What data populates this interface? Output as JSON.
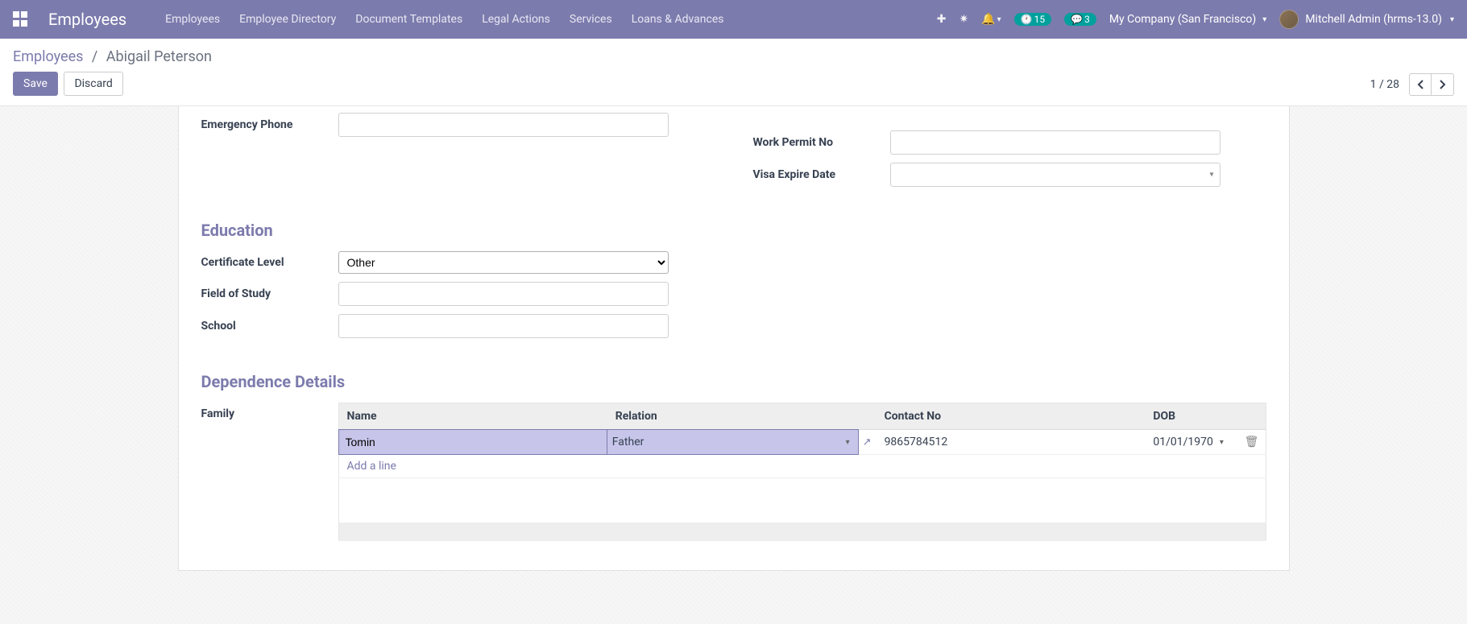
{
  "nav": {
    "brand": "Employees",
    "links": [
      "Employees",
      "Employee Directory",
      "Document Templates",
      "Legal Actions",
      "Services",
      "Loans & Advances"
    ],
    "activities": "15",
    "discuss": "3",
    "company": "My Company (San Francisco)",
    "user": "Mitchell Admin (hrms-13.0)"
  },
  "breadcrumbs": {
    "root": "Employees",
    "current": "Abigail Peterson"
  },
  "buttons": {
    "save": "Save",
    "discard": "Discard"
  },
  "pager": {
    "value": "1 / 28"
  },
  "fields": {
    "emergency_phone": "Emergency Phone",
    "work_permit_no": "Work Permit No",
    "visa_expire": "Visa Expire Date",
    "certificate_level": "Certificate Level",
    "certificate_value": "Other",
    "field_of_study": "Field of Study",
    "school": "School",
    "family": "Family"
  },
  "sections": {
    "education": "Education",
    "dependence": "Dependence Details"
  },
  "table": {
    "headers": {
      "name": "Name",
      "relation": "Relation",
      "contact": "Contact No",
      "dob": "DOB"
    },
    "rows": [
      {
        "name": "Tomin",
        "relation": "Father",
        "contact": "9865784512",
        "dob": "01/01/1970"
      }
    ],
    "add_line": "Add a line"
  }
}
